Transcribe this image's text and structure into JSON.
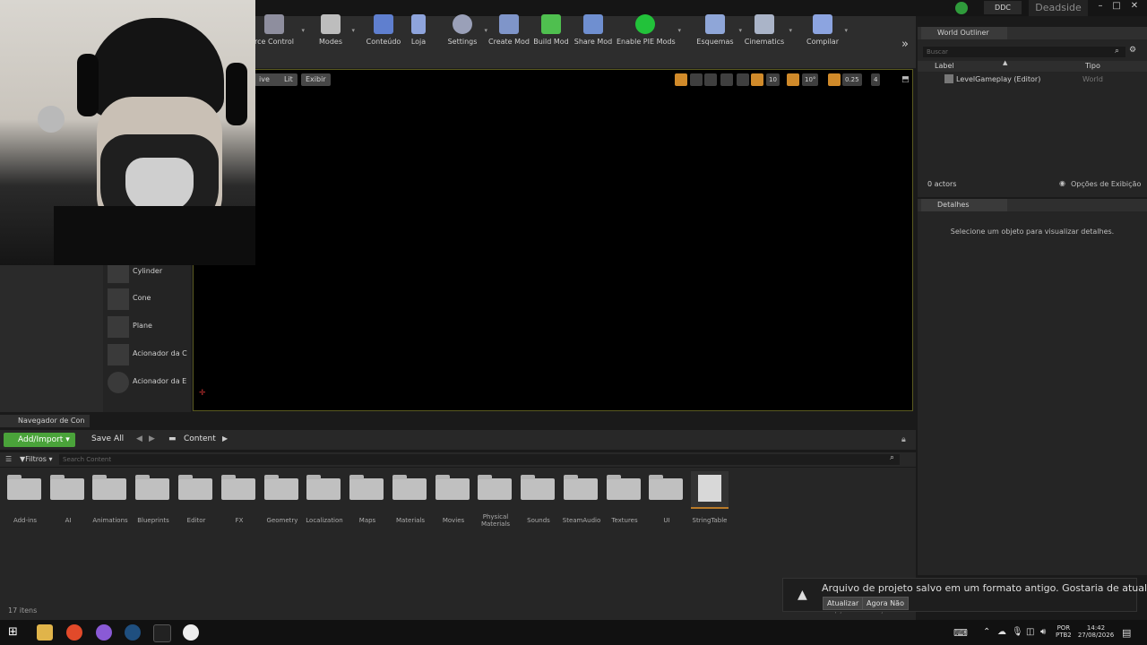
{
  "titlebar": {
    "ddc_label": "DDC",
    "project_name": "Deadside"
  },
  "toolbar": {
    "items": [
      {
        "label": "rce Control"
      },
      {
        "label": "Modes"
      },
      {
        "label": "Conteúdo"
      },
      {
        "label": "Loja"
      },
      {
        "label": "Settings"
      },
      {
        "label": "Create Mod"
      },
      {
        "label": "Build Mod"
      },
      {
        "label": "Share Mod"
      },
      {
        "label": "Enable PIE Mods"
      },
      {
        "label": "Esquemas"
      },
      {
        "label": "Cinematics"
      },
      {
        "label": "Compilar"
      }
    ],
    "overflow": "»"
  },
  "viewport": {
    "buttons": [
      "ive",
      "Lit",
      "Exibir"
    ],
    "grid_value": "10",
    "angle_value": "10°",
    "scale_value": "0.25",
    "camera_speed": "4"
  },
  "shapes": [
    {
      "label": "Cylinder"
    },
    {
      "label": "Cone"
    },
    {
      "label": "Plane"
    },
    {
      "label": "Acionador da C"
    },
    {
      "label": "Acionador da E"
    }
  ],
  "outliner": {
    "tab": "World Outliner",
    "search_placeholder": "Buscar",
    "col_label": "Label",
    "col_type": "Tipo",
    "row_label": "LevelGameplay (Editor)",
    "row_type": "World",
    "count": "0 actors",
    "view_options": "Opções de Exibição"
  },
  "details": {
    "tab": "Detalhes",
    "empty_text": "Selecione um objeto para visualizar detalhes."
  },
  "content_browser": {
    "tab": "Navegador de Con",
    "add_import": "Add/Import",
    "save_all": "Save All",
    "path": "Content",
    "filters": "Filtros",
    "search_placeholder": "Search Content",
    "items_count": "17 itens",
    "folders": [
      "Add-ins",
      "AI",
      "Animations",
      "Blueprints",
      "Editor",
      "FX",
      "Geometry",
      "Localization",
      "Maps",
      "Materials",
      "Movies",
      "Physical Materials",
      "Sounds",
      "SteamAudio",
      "Textures",
      "UI"
    ],
    "asset": "StringTable"
  },
  "toast": {
    "message": "Arquivo de projeto salvo em um formato antigo. Gostaria de atualizá-lo?",
    "update": "Atualizar",
    "not_now": "Agora Não",
    "behind_text": "Opções de Exibição"
  },
  "taskbar": {
    "lang_top": "POR",
    "lang_bottom": "PTB2",
    "time": "14:42",
    "date": "27/08/2026"
  }
}
